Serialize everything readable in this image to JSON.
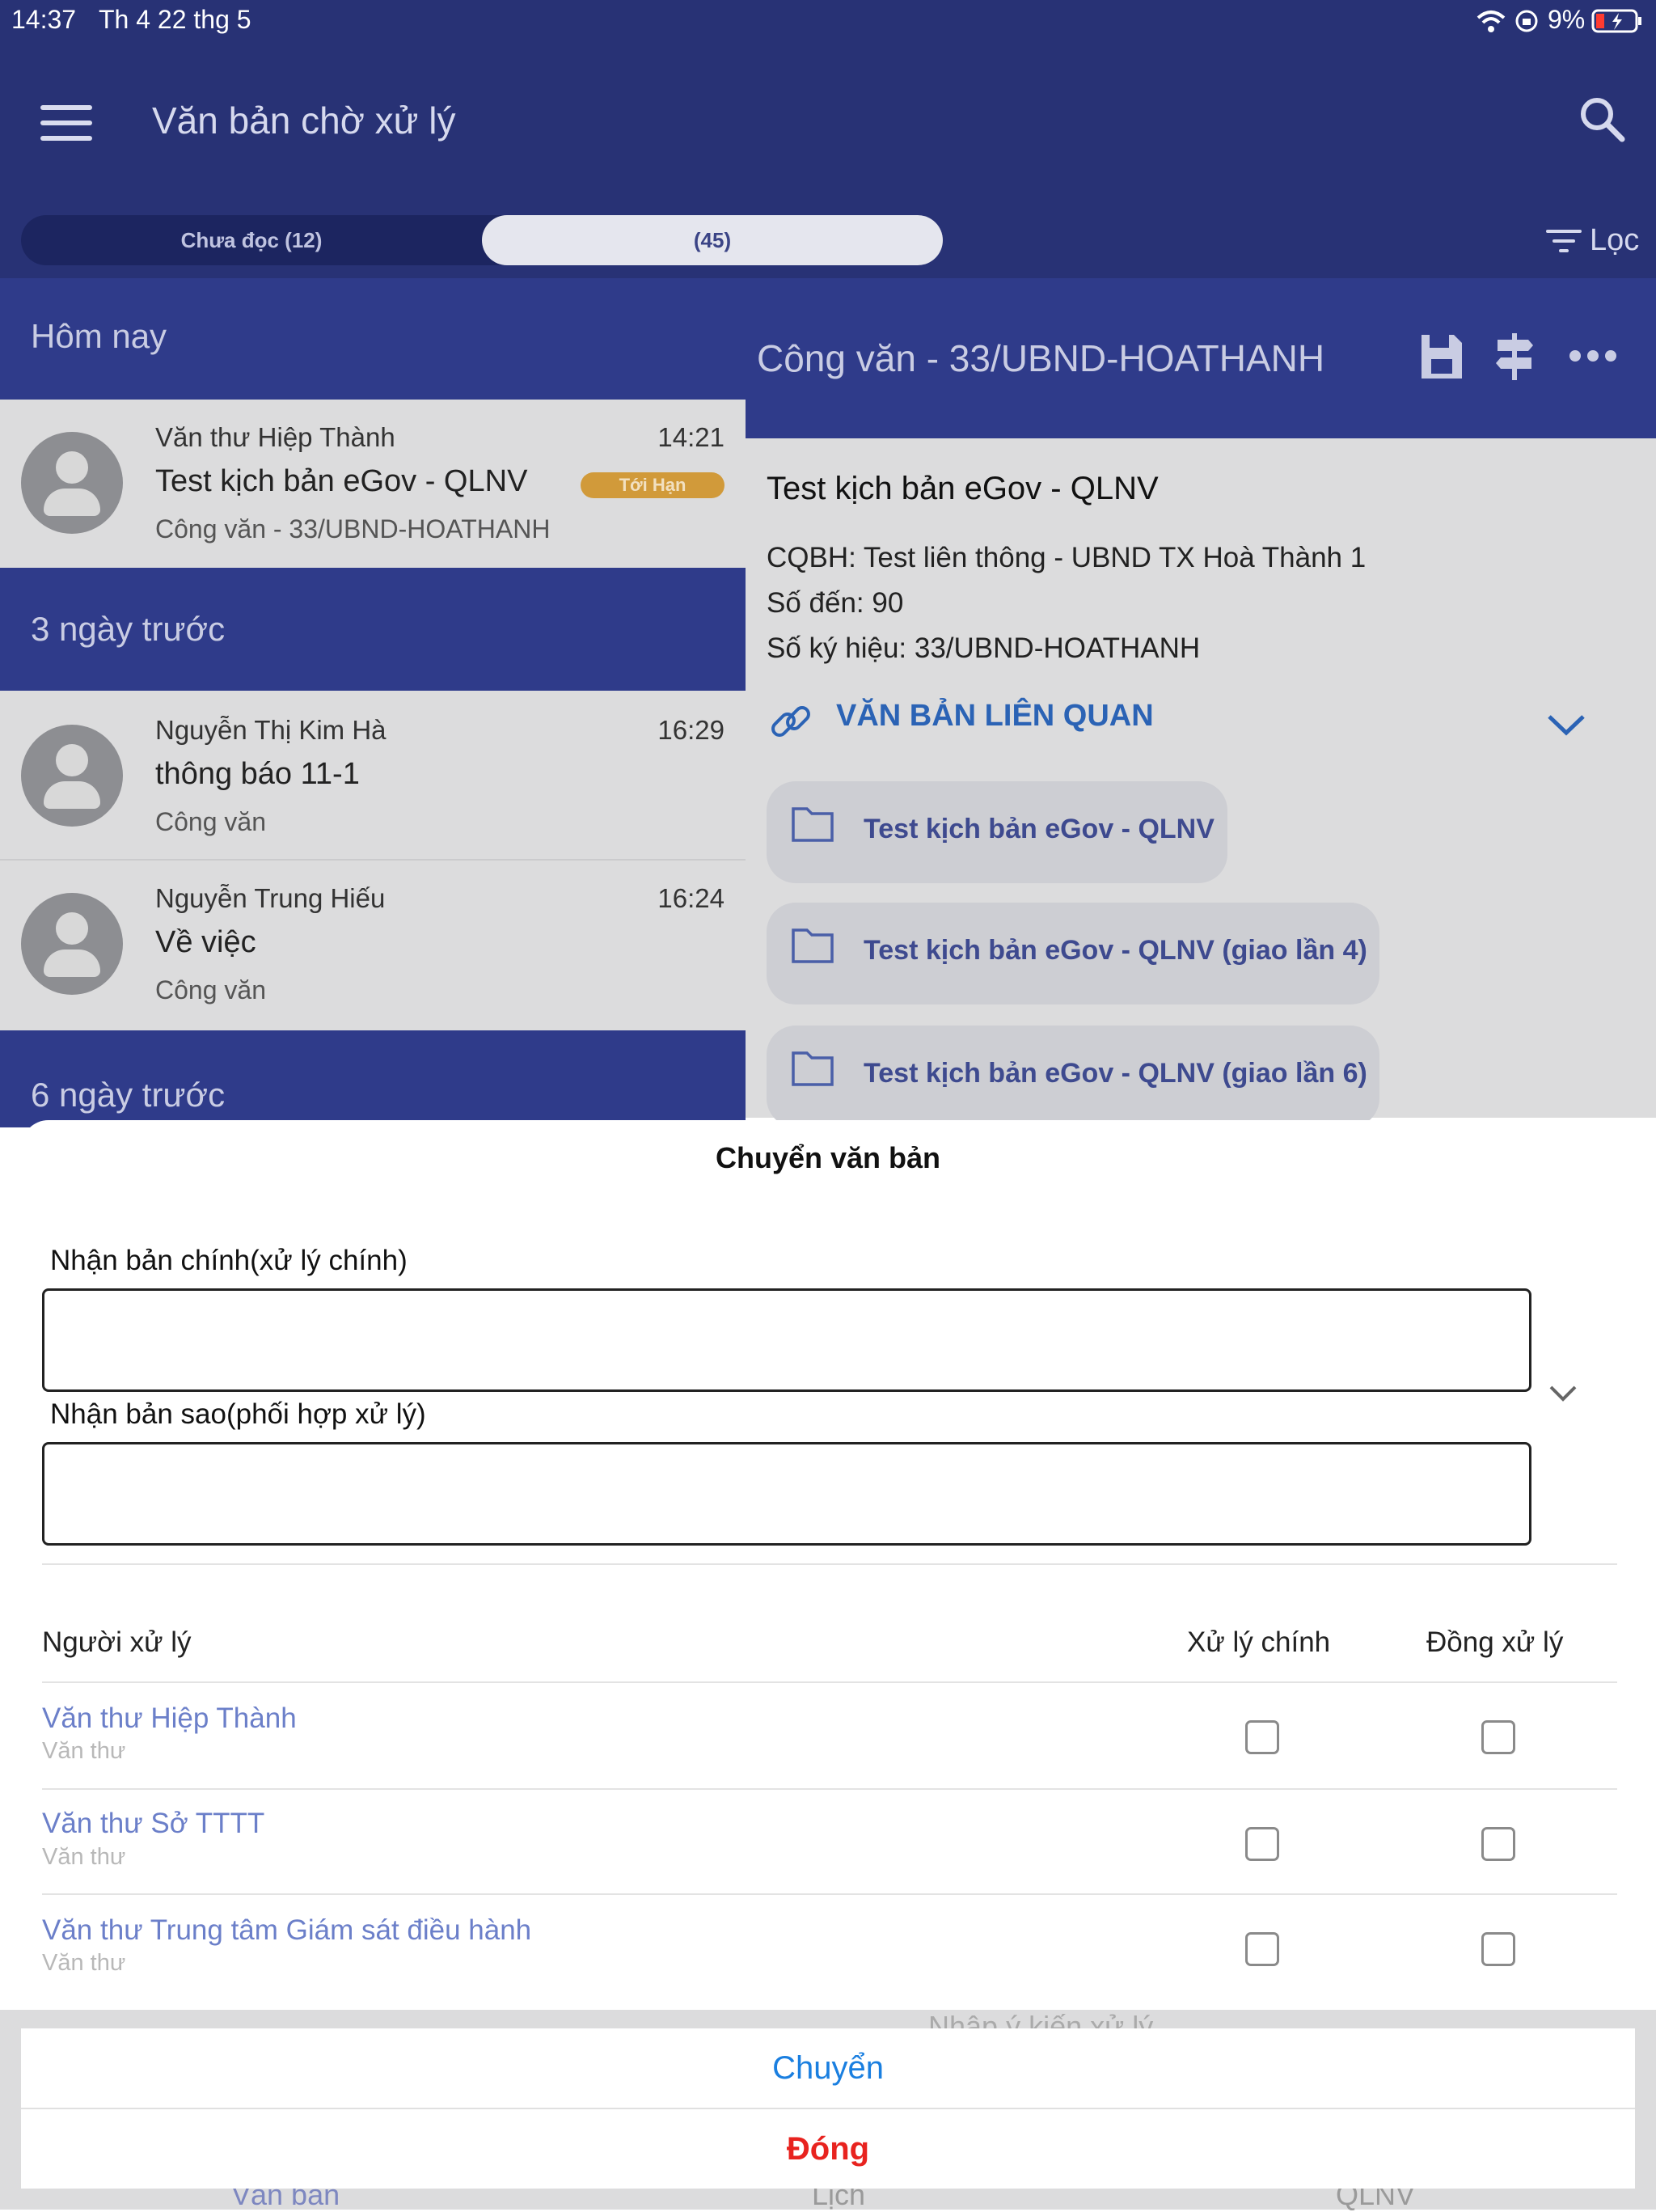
{
  "status": {
    "time": "14:37",
    "date": "Th 4 22 thg 5",
    "battery": "9%"
  },
  "header": {
    "title": "Văn bản chờ xử lý",
    "filter_label": "Lọc"
  },
  "tabs": [
    {
      "label": "Chưa đọc (12)"
    },
    {
      "label": "(45)"
    }
  ],
  "list": {
    "sections": [
      {
        "title": "Hôm nay"
      },
      {
        "title": "3 ngày trước"
      },
      {
        "title": "6 ngày trước"
      }
    ],
    "items": [
      {
        "sender": "Văn thư Hiệp Thành",
        "time": "14:21",
        "subject": "Test kịch bản eGov - QLNV",
        "badge": "Tới Hạn",
        "kind": "Công văn - 33/UBND-HOATHANH"
      },
      {
        "sender": "Nguyễn Thị Kim Hà",
        "time": "16:29",
        "subject": "thông báo 11-1",
        "kind": "Công văn"
      },
      {
        "sender": "Nguyễn Trung  Hiếu",
        "time": "16:24",
        "subject": "Về việc",
        "kind": "Công văn"
      }
    ]
  },
  "detail": {
    "header_title": "Công văn - 33/UBND-HOATHANH",
    "title": "Test kịch bản eGov - QLNV",
    "cqbh": "CQBH: Test liên thông - UBND TX Hoà Thành 1",
    "so_den": "Số đến: 90",
    "so_ky_hieu": "Số ký hiệu: 33/UBND-HOATHANH",
    "related_label": "VĂN BẢN LIÊN QUAN",
    "related": [
      "Test kịch bản eGov - QLNV",
      "Test kịch bản eGov - QLNV (giao lần 4)",
      "Test kịch bản eGov - QLNV (giao lần 6)"
    ],
    "comment_placeholder": "Nhập ý kiến xử lý"
  },
  "modal": {
    "title": "Chuyển văn bản",
    "main_label": "Nhận bản chính(xử lý chính)",
    "copy_label": "Nhận bản sao(phối hợp xử lý)",
    "col_person": "Người xử lý",
    "col_main": "Xử lý chính",
    "col_co": "Đồng xử lý",
    "people": [
      {
        "name": "Văn thư Hiệp Thành",
        "role": "Văn thư"
      },
      {
        "name": "Văn thư Sở TTTT",
        "role": "Văn thư"
      },
      {
        "name": "Văn thư Trung tâm Giám sát điều hành",
        "role": "Văn thư"
      }
    ]
  },
  "actions": {
    "submit": "Chuyển",
    "close": "Đóng"
  },
  "tabbar": [
    "Văn bản",
    "Lịch",
    "QLNV"
  ],
  "colors": {
    "primary": "#283275",
    "link": "#1a7fe0",
    "danger": "#e8231f",
    "badge": "#d19a3a"
  }
}
